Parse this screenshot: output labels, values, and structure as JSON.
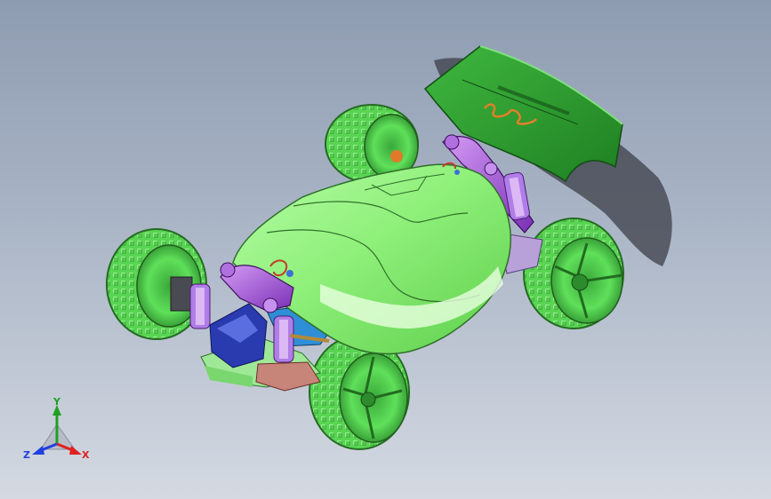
{
  "viewport": {
    "background_top": "#8e9cb1",
    "background_bottom": "#d4d9e2"
  },
  "model": {
    "body_color": "#8ff07a",
    "tire_color": "#4fd64a",
    "wing_color": "#2f9e2f",
    "suspension_color": "#a64fd8",
    "chassis_blue": "#2a3bb0"
  },
  "triad": {
    "x_label": "X",
    "y_label": "Y",
    "z_label": "Z",
    "x_color": "#e02020",
    "y_color": "#20a020",
    "z_color": "#2040e0"
  }
}
